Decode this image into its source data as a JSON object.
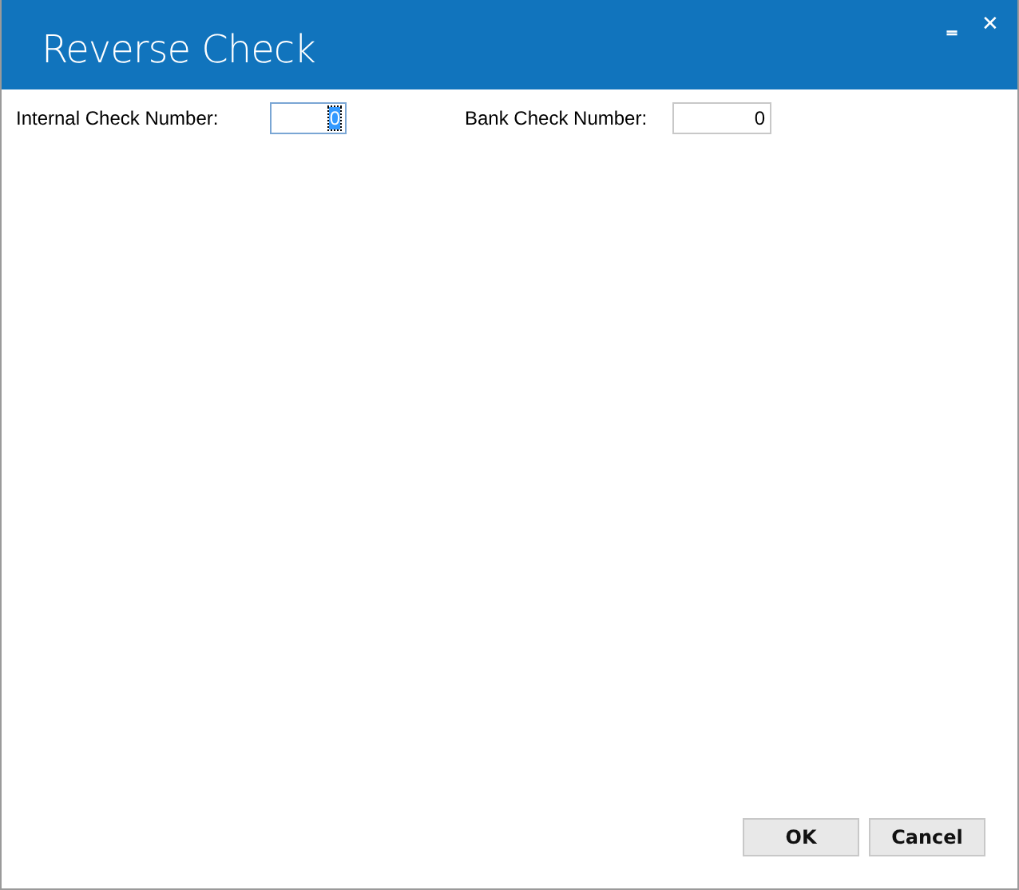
{
  "window": {
    "title": "Reverse Check",
    "controls": [
      "‗",
      "✕"
    ]
  },
  "fields": [
    {
      "label": "Internal Check Number:",
      "value": "0",
      "focused": true
    },
    {
      "label": "Bank Check Number:",
      "value": "0",
      "focused": false
    }
  ],
  "buttons": [
    "OK",
    "Cancel"
  ]
}
